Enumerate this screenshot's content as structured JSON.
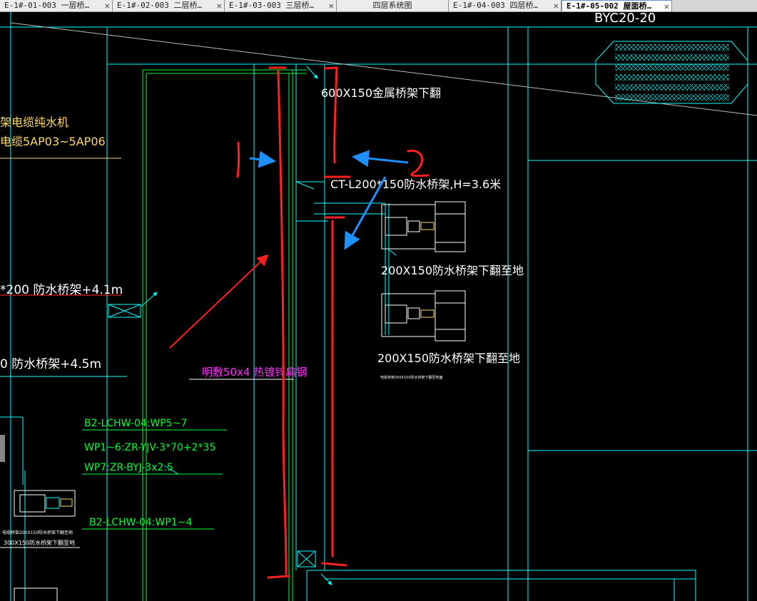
{
  "tabs": [
    {
      "label": "E-1#-01-003 一层桥…",
      "close": "✕",
      "active": false
    },
    {
      "label": "E-1#-02-003 二层桥…",
      "close": "✕",
      "active": false
    },
    {
      "label": "E-1#-03-003 三层桥…",
      "close": "✕",
      "active": false
    },
    {
      "label": "四层系统图",
      "close": "",
      "active": false
    },
    {
      "label": "E-1#-04-003 四层桥…",
      "close": "✕",
      "active": false
    },
    {
      "label": "E-1#-05-002 屋面桥…",
      "close": "✕",
      "active": true
    }
  ],
  "drawing": {
    "top_label": "BYC20-20",
    "tray_600x150": "600X150金属桥架下翻",
    "tray_ct": "CT-L200*150防水桥架,H=3.6米",
    "tray_200x150_a": "200X150防水桥架下翻至地",
    "tray_200x150_b": "200X150防水桥架下翻至地",
    "tiny_note": "电缆桥架200X150防水桥架下翻至地面",
    "cable_line1": "架电缆纯水机",
    "cable_line2": "电缆5AP03~5AP06",
    "tray_41m": "*200  防水桥架+4.1m",
    "tray_45m": "0  防水桥架+4.5m",
    "flat_steel": "明敷50x4 热镀锌扁钢",
    "green_1": "B2-LCHW-04:WP5~7",
    "green_2": "WP1~6:ZR-YJV-3*70+2*35",
    "green_3": "WP7:ZR-BYJ-3x2.5",
    "green_4": "B2-LCHW-04:WP1~4",
    "small_tray_note": "300X150防水桥架下翻至地",
    "small_equip_note": "电缆桥架200X150防水桥架下翻至地",
    "markup_1": "1",
    "markup_2": "2"
  },
  "colors": {
    "background": "#000000",
    "cyan": "#00ffff",
    "green": "#00ff33",
    "white": "#ffffff",
    "yellow": "#ffd966",
    "magenta": "#ff33ff",
    "red_markup": "#ff2020",
    "blue_markup": "#1e90ff"
  }
}
